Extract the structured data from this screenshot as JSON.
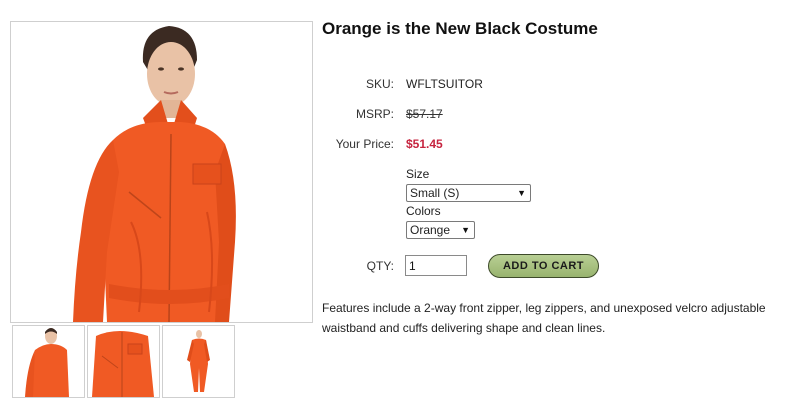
{
  "product": {
    "title": "Orange is the New Black Costume",
    "sku_label": "SKU:",
    "sku": "WFLTSUITOR",
    "msrp_label": "MSRP:",
    "msrp": "$57.17",
    "price_label": "Your Price:",
    "price": "$51.45",
    "size_label": "Size",
    "size_selected": "Small (S)",
    "colors_label": "Colors",
    "color_selected": "Orange",
    "qty_label": "QTY:",
    "qty_value": "1",
    "add_to_cart_label": "ADD TO CART",
    "description": "Features include a 2-way front zipper, leg zippers, and unexposed velcro adjustable waistband and cuffs delivering shape and clean lines."
  },
  "colors": {
    "price": "#c6243f",
    "cart_button": "#a7c07f",
    "suit_orange": "#f05a24"
  },
  "icons": {
    "dropdown": "dropdown-arrow-icon"
  }
}
